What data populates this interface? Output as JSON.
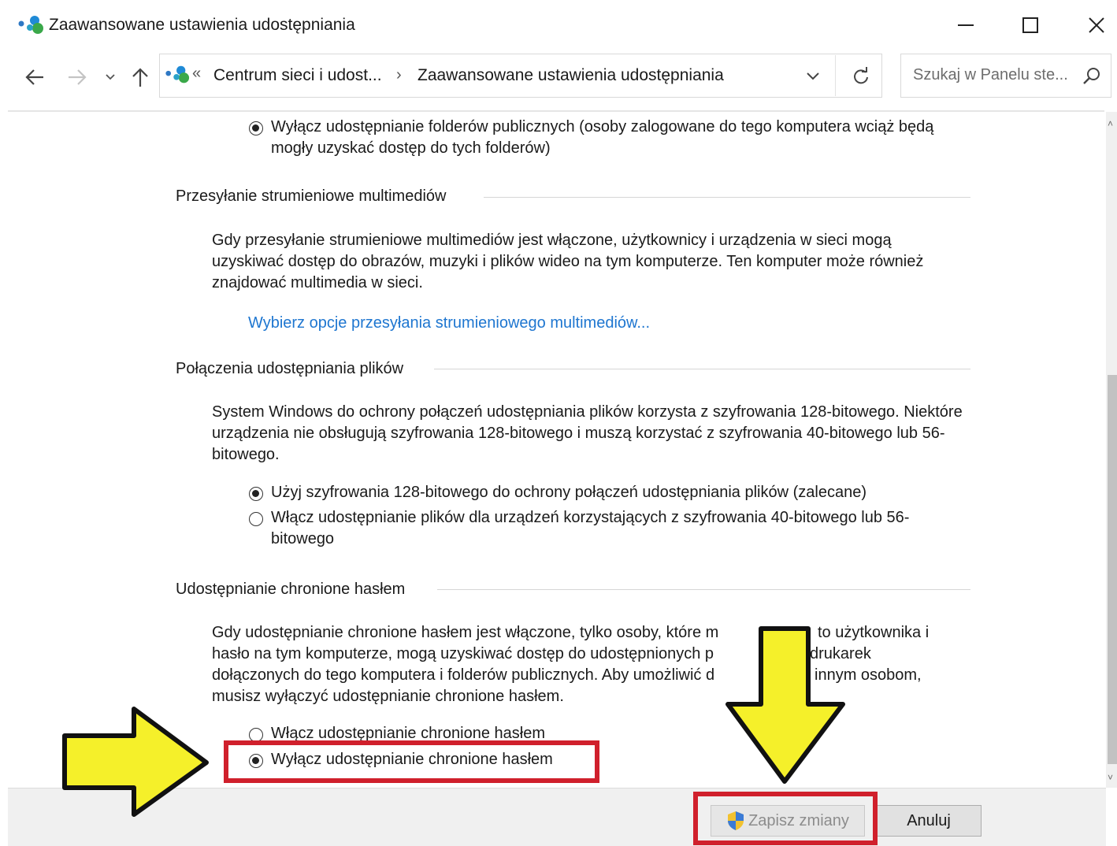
{
  "window": {
    "title": "Zaawansowane ustawienia udostępniania",
    "minimize_icon": "minimize-icon",
    "maximize_icon": "maximize-icon",
    "close_icon": "close-icon"
  },
  "navigation": {
    "address_prefix": "«",
    "breadcrumb": [
      "Centrum sieci i udost...",
      "Zaawansowane ustawienia udostępniania"
    ],
    "breadcrumb_separator": "›",
    "search_placeholder": "Szukaj w Panelu ste..."
  },
  "content": {
    "public_folders": {
      "option_off": "Wyłącz udostępnianie folderów publicznych (osoby zalogowane do tego komputera wciąż będą mogły uzyskać dostęp do tych folderów)",
      "option_off_checked": true
    },
    "media_streaming": {
      "title": "Przesyłanie strumieniowe multimediów",
      "description": "Gdy przesyłanie strumieniowe multimediów jest włączone, użytkownicy i urządzenia w sieci mogą uzyskiwać dostęp do obrazów, muzyki i plików wideo na tym komputerze. Ten komputer może również znajdować multimedia w sieci.",
      "link": "Wybierz opcje przesyłania strumieniowego multimediów..."
    },
    "file_sharing": {
      "title": "Połączenia udostępniania plików",
      "description": "System Windows do ochrony połączeń udostępniania plików korzysta z szyfrowania 128-bitowego. Niektóre urządzenia nie obsługują szyfrowania 128-bitowego i muszą korzystać z szyfrowania 40-bitowego lub 56-bitowego.",
      "options": [
        {
          "label": "Użyj szyfrowania 128-bitowego do ochrony połączeń udostępniania plików (zalecane)",
          "checked": true
        },
        {
          "label": "Włącz udostępnianie plików dla urządzeń korzystających z szyfrowania 40-bitowego lub 56-bitowego",
          "checked": false
        }
      ]
    },
    "password_protected": {
      "title": "Udostępnianie chronione hasłem",
      "description": "Gdy udostępnianie chronione hasłem jest włączone, tylko osoby, które m... konto użytkownika i hasło na tym komputerze, mogą uzyskiwać dostęp do udostępnionych p... drukarek dołączonych do tego komputera i folderów publicznych. Aby umożliwić d... innym osobom, musisz wyłączyć udostępnianie chronione hasłem.",
      "description_lines": [
        "Gdy udostępnianie chronione hasłem jest włączone, tylko osoby, które m",
        "to użytkownika i",
        "hasło na tym komputerze, mogą uzyskiwać dostęp do udostępnionych p",
        "drukarek",
        "dołączonych do tego komputera i folderów publicznych. Aby umożliwić d",
        "innym osobom,",
        "musisz wyłączyć udostępnianie chronione hasłem."
      ],
      "options": [
        {
          "label": "Włącz udostępnianie chronione hasłem",
          "checked": false
        },
        {
          "label": "Wyłącz udostępnianie chronione hasłem",
          "checked": true
        }
      ]
    }
  },
  "footer": {
    "save_label": "Zapisz zmiany",
    "save_icon": "uac-shield-icon",
    "cancel_label": "Anuluj"
  },
  "annotations": {
    "highlight_color": "#d0202c",
    "arrow_color": "#f5f02a"
  }
}
